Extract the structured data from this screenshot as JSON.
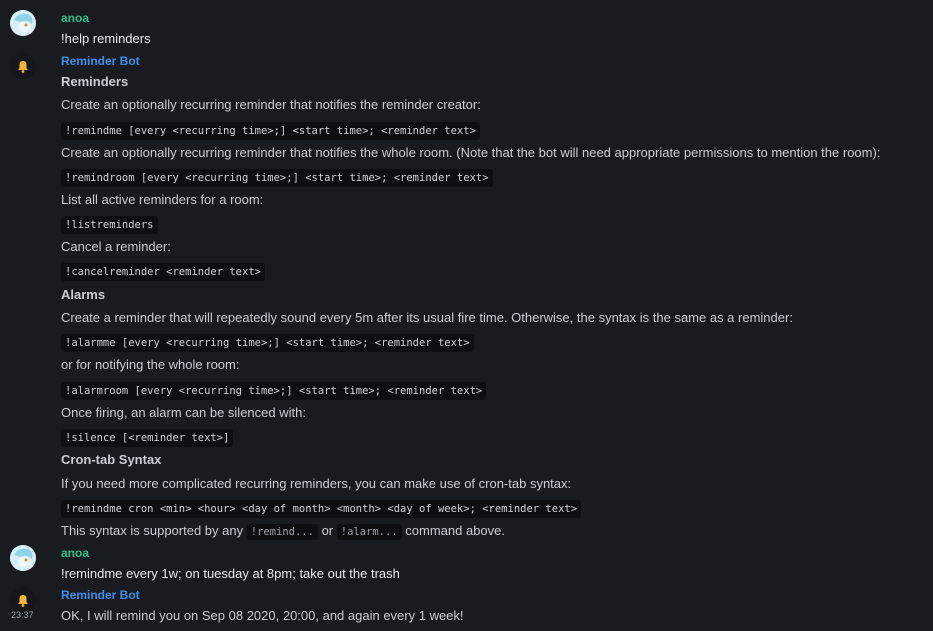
{
  "messages": [
    {
      "sender": "anoa",
      "body": "!help reminders"
    },
    {
      "sender": "Reminder Bot",
      "sections": {
        "reminders_heading": "Reminders",
        "r1_text": "Create an optionally recurring reminder that notifies the reminder creator:",
        "r1_code": "!remindme [every <recurring time>;] <start time>; <reminder text>",
        "r2_text": "Create an optionally recurring reminder that notifies the whole room. (Note that the bot will need appropriate permissions to mention the room):",
        "r2_code": "!remindroom [every <recurring time>;] <start time>; <reminder text>",
        "r3_text": "List all active reminders for a room:",
        "r3_code": "!listreminders",
        "r4_text": "Cancel a reminder:",
        "r4_code": "!cancelreminder <reminder text>",
        "alarms_heading": "Alarms",
        "a1_text": "Create a reminder that will repeatedly sound every 5m after its usual fire time. Otherwise, the syntax is the same as a reminder:",
        "a1_code": "!alarmme [every <recurring time>;] <start time>; <reminder text>",
        "a2_text": "or for notifying the whole room:",
        "a2_code": "!alarmroom [every <recurring time>;] <start time>; <reminder text>",
        "a3_text": "Once firing, an alarm can be silenced with:",
        "a3_code": "!silence [<reminder text>]",
        "cron_heading": "Cron-tab Syntax",
        "c1_text": "If you need more complicated recurring reminders, you can make use of cron-tab syntax:",
        "c1_code": "!remindme cron <min> <hour> <day of month> <month> <day of week>; <reminder text>",
        "c2_pre": "This syntax is supported by any",
        "c2_code1": "!remind...",
        "c2_mid": "or",
        "c2_code2": "!alarm...",
        "c2_post": "command above."
      }
    },
    {
      "sender": "anoa",
      "body": "!remindme every 1w; on tuesday at 8pm; take out the trash"
    },
    {
      "sender": "Reminder Bot",
      "body": "OK, I will remind you on Sep 08 2020, 20:00, and again every 1 week!",
      "timestamp": "23:37"
    }
  ],
  "icons": {
    "bot_avatar": "bell-icon",
    "user_avatar": "pony-avatar"
  },
  "colors": {
    "user_name": "#2fbf8a",
    "bot_name": "#3f8ee8",
    "background": "#181b20"
  }
}
